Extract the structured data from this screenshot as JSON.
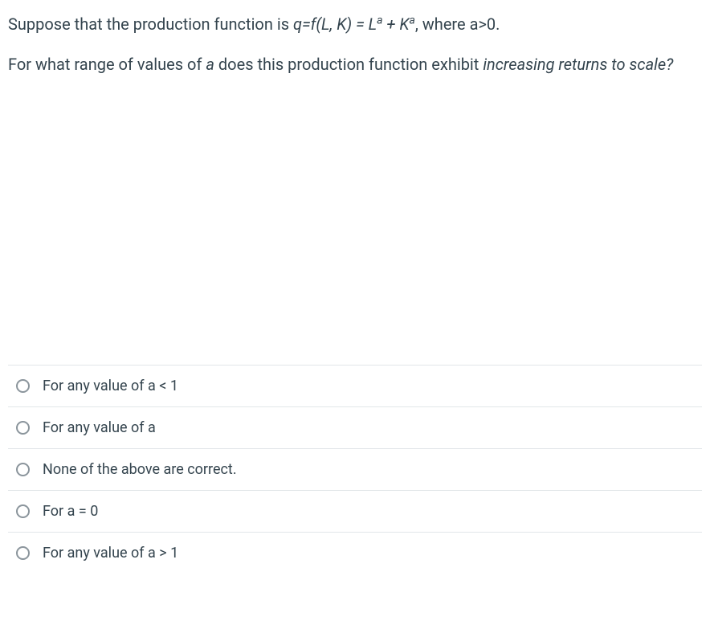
{
  "question": {
    "line1_pre": "Suppose that the production function is ",
    "line1_func": "q=f(L, K) = L",
    "line1_sup1": "a",
    "line1_mid": " + K",
    "line1_sup2": "a",
    "line1_post": ", where a>0.",
    "line2_pre": "For what range of values of ",
    "line2_a": "a",
    "line2_mid": " does this production function exhibit ",
    "line2_irs": "increasing returns to scale?"
  },
  "options": [
    {
      "label": "For any value of a < 1"
    },
    {
      "label": "For any value of a"
    },
    {
      "label": "None of the above are correct."
    },
    {
      "label": "For a = 0"
    },
    {
      "label": "For any value of a > 1"
    }
  ]
}
